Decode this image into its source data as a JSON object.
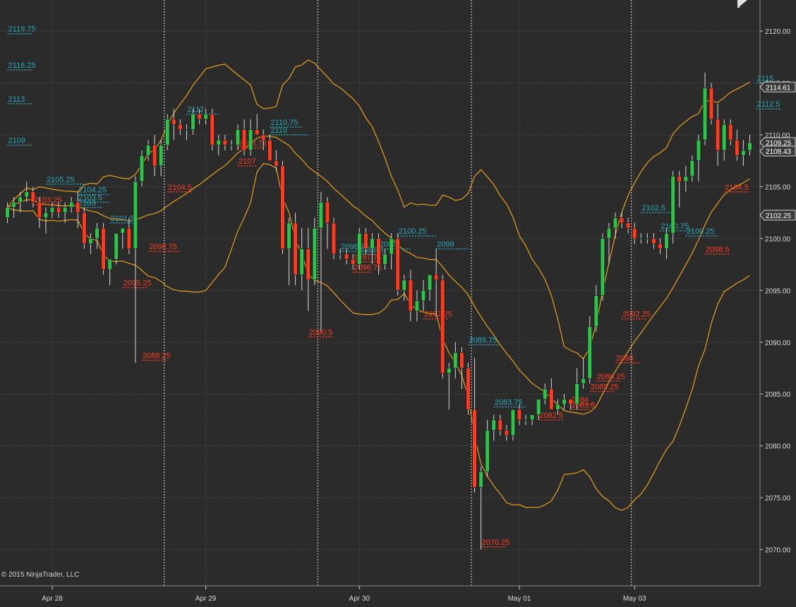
{
  "copyright": "© 2015 NinjaTrader, LLC",
  "colors": {
    "background": "#2b2b2b",
    "grid": "#555555",
    "separator": "#d8d8d8",
    "up_candle": "#2ec44a",
    "down_candle": "#ff3b1f",
    "wick": "#d8d8d8",
    "bollinger": "#e8a11a",
    "swing_high": "#2aa8b8",
    "swing_low": "#ff3b1f",
    "axis_text": "#d8d8d8"
  },
  "chart_data": {
    "type": "candlestick",
    "title": "",
    "xlabel": "",
    "ylabel": "",
    "ylim": [
      2066.5,
      2123.0
    ],
    "y_ticks": [
      2070.0,
      2075.0,
      2080.0,
      2085.0,
      2090.0,
      2095.0,
      2100.0,
      2105.0,
      2110.0,
      2115.0,
      2120.0
    ],
    "y_tick_labels": [
      "2070.00",
      "2075.00",
      "2080.00",
      "2085.00",
      "2090.00",
      "2095.00",
      "2100.00",
      "2105.00",
      "2110.00",
      "2115.00",
      "2120.00"
    ],
    "x_tick_labels": [
      "Apr 28",
      "Apr 29",
      "Apr 30",
      "May 01",
      "May 03"
    ],
    "x_tick_bars": [
      7,
      31,
      55,
      80,
      98
    ],
    "session_breaks": [
      25,
      49,
      73,
      98
    ],
    "grid": true,
    "price_markers": [
      {
        "label": "2114.61",
        "value": 2114.61
      },
      {
        "label": "2109.25",
        "value": 2109.25
      },
      {
        "label": "2108.43",
        "value": 2108.43
      },
      {
        "label": "2102.25",
        "value": 2102.25
      }
    ],
    "candles": [
      [
        2102.0,
        2103.5,
        2101.5,
        2103.0
      ],
      [
        2103.0,
        2104.0,
        2102.0,
        2103.5
      ],
      [
        2103.5,
        2104.5,
        2102.5,
        2104.0
      ],
      [
        2104.0,
        2105.5,
        2103.5,
        2104.5
      ],
      [
        2104.5,
        2105.0,
        2103.0,
        2103.5
      ],
      [
        2103.5,
        2104.0,
        2101.0,
        2102.0
      ],
      [
        2102.0,
        2103.0,
        2100.5,
        2102.5
      ],
      [
        2102.5,
        2103.5,
        2102.0,
        2103.0
      ],
      [
        2103.0,
        2103.5,
        2102.0,
        2102.5
      ],
      [
        2102.5,
        2103.5,
        2101.5,
        2103.0
      ],
      [
        2103.0,
        2104.0,
        2102.5,
        2103.5
      ],
      [
        2103.5,
        2104.5,
        2101.0,
        2102.5
      ],
      [
        2102.5,
        2103.0,
        2099.0,
        2099.5
      ],
      [
        2099.5,
        2100.5,
        2098.5,
        2100.0
      ],
      [
        2100.0,
        2101.5,
        2099.0,
        2101.0
      ],
      [
        2101.0,
        2101.5,
        2096.5,
        2097.0
      ],
      [
        2097.0,
        2098.0,
        2095.5,
        2098.0
      ],
      [
        2098.0,
        2100.5,
        2097.5,
        2100.5
      ],
      [
        2100.5,
        2101.0,
        2099.0,
        2101.0
      ],
      [
        2101.0,
        2102.0,
        2098.5,
        2099.0
      ],
      [
        2099.0,
        2106.0,
        2088.0,
        2105.5
      ],
      [
        2105.5,
        2108.5,
        2105.0,
        2108.0
      ],
      [
        2108.0,
        2109.5,
        2107.5,
        2109.0
      ],
      [
        2109.0,
        2110.0,
        2106.0,
        2107.0
      ],
      [
        2107.0,
        2109.5,
        2106.0,
        2109.0
      ],
      [
        2109.0,
        2112.0,
        2108.5,
        2111.5
      ],
      [
        2111.5,
        2112.5,
        2109.5,
        2111.0
      ],
      [
        2111.0,
        2111.5,
        2110.0,
        2110.5
      ],
      [
        2110.5,
        2111.0,
        2109.5,
        2110.5
      ],
      [
        2110.5,
        2112.5,
        2110.0,
        2112.0
      ],
      [
        2112.0,
        2112.5,
        2111.0,
        2111.5
      ],
      [
        2111.5,
        2112.5,
        2111.0,
        2112.0
      ],
      [
        2112.0,
        2112.5,
        2108.5,
        2109.0
      ],
      [
        2109.0,
        2110.0,
        2108.0,
        2109.5
      ],
      [
        2109.5,
        2110.0,
        2108.5,
        2109.0
      ],
      [
        2109.0,
        2109.5,
        2108.5,
        2109.0
      ],
      [
        2109.0,
        2111.0,
        2108.5,
        2110.5
      ],
      [
        2110.5,
        2111.5,
        2108.0,
        2108.5
      ],
      [
        2108.5,
        2111.5,
        2108.0,
        2110.5
      ],
      [
        2110.5,
        2112.0,
        2110.0,
        2110.0
      ],
      [
        2110.0,
        2110.5,
        2108.5,
        2109.5
      ],
      [
        2109.5,
        2110.0,
        2107.5,
        2107.5
      ],
      [
        2107.5,
        2108.5,
        2106.5,
        2107.0
      ],
      [
        2107.0,
        2107.5,
        2098.5,
        2099.0
      ],
      [
        2099.0,
        2102.0,
        2095.5,
        2101.5
      ],
      [
        2101.5,
        2102.5,
        2095.5,
        2096.5
      ],
      [
        2096.5,
        2101.0,
        2095.0,
        2099.0
      ],
      [
        2099.0,
        2101.0,
        2093.0,
        2096.0
      ],
      [
        2096.0,
        2102.0,
        2095.5,
        2101.0
      ],
      [
        2101.0,
        2104.5,
        2091.0,
        2103.5
      ],
      [
        2103.5,
        2104.0,
        2099.0,
        2101.5
      ],
      [
        2101.5,
        2102.0,
        2098.0,
        2098.5
      ],
      [
        2098.5,
        2099.0,
        2098.0,
        2098.5
      ],
      [
        2098.5,
        2099.0,
        2097.5,
        2098.0
      ],
      [
        2098.0,
        2098.5,
        2097.0,
        2097.5
      ],
      [
        2097.5,
        2101.0,
        2097.0,
        2100.5
      ],
      [
        2100.5,
        2101.0,
        2098.5,
        2099.0
      ],
      [
        2099.0,
        2100.5,
        2097.5,
        2100.0
      ],
      [
        2100.0,
        2100.5,
        2096.5,
        2097.5
      ],
      [
        2097.5,
        2099.0,
        2097.0,
        2098.5
      ],
      [
        2098.5,
        2100.5,
        2097.0,
        2100.0
      ],
      [
        2100.0,
        2100.5,
        2094.5,
        2095.0
      ],
      [
        2095.0,
        2096.5,
        2094.0,
        2096.0
      ],
      [
        2096.0,
        2097.0,
        2092.0,
        2093.0
      ],
      [
        2093.0,
        2095.0,
        2092.0,
        2094.0
      ],
      [
        2094.0,
        2096.0,
        2093.0,
        2095.0
      ],
      [
        2095.0,
        2096.5,
        2094.0,
        2096.5
      ],
      [
        2096.5,
        2099.0,
        2092.5,
        2096.0
      ],
      [
        2096.0,
        2096.5,
        2086.5,
        2087.0
      ],
      [
        2087.0,
        2088.0,
        2083.5,
        2087.5
      ],
      [
        2087.5,
        2090.0,
        2086.5,
        2089.0
      ],
      [
        2089.0,
        2089.5,
        2085.5,
        2087.5
      ],
      [
        2087.5,
        2088.0,
        2083.0,
        2083.5
      ],
      [
        2083.5,
        2088.5,
        2075.5,
        2076.0
      ],
      [
        2076.0,
        2078.0,
        2070.0,
        2077.5
      ],
      [
        2077.5,
        2082.5,
        2077.0,
        2081.5
      ],
      [
        2081.5,
        2083.0,
        2080.5,
        2082.5
      ],
      [
        2082.5,
        2083.0,
        2081.0,
        2081.5
      ],
      [
        2081.5,
        2082.0,
        2080.5,
        2081.0
      ],
      [
        2081.0,
        2083.5,
        2080.5,
        2083.5
      ],
      [
        2083.5,
        2084.0,
        2082.0,
        2082.5
      ],
      [
        2082.5,
        2083.0,
        2082.0,
        2082.5
      ],
      [
        2082.5,
        2083.0,
        2082.0,
        2083.0
      ],
      [
        2083.0,
        2084.5,
        2082.5,
        2084.5
      ],
      [
        2084.5,
        2086.0,
        2084.0,
        2085.5
      ],
      [
        2085.5,
        2086.5,
        2083.5,
        2083.5
      ],
      [
        2083.5,
        2084.5,
        2083.0,
        2084.0
      ],
      [
        2084.0,
        2085.0,
        2083.5,
        2084.5
      ],
      [
        2084.5,
        2084.5,
        2083.5,
        2084.0
      ],
      [
        2084.0,
        2087.5,
        2083.5,
        2086.0
      ],
      [
        2086.0,
        2088.5,
        2085.5,
        2086.5
      ],
      [
        2086.5,
        2092.5,
        2086.0,
        2091.5
      ],
      [
        2091.5,
        2095.5,
        2091.0,
        2094.5
      ],
      [
        2094.5,
        2100.5,
        2094.0,
        2100.0
      ],
      [
        2100.0,
        2101.5,
        2097.5,
        2101.0
      ],
      [
        2101.0,
        2102.5,
        2100.0,
        2102.0
      ],
      [
        2102.0,
        2102.5,
        2101.0,
        2101.5
      ],
      [
        2101.5,
        2102.0,
        2100.5,
        2101.0
      ],
      [
        2101.0,
        2101.5,
        2099.5,
        2100.0
      ],
      [
        2100.0,
        2100.5,
        2099.5,
        2100.0
      ],
      [
        2100.0,
        2100.5,
        2099.5,
        2100.0
      ],
      [
        2100.0,
        2100.5,
        2099.0,
        2099.5
      ],
      [
        2099.5,
        2100.0,
        2098.5,
        2099.0
      ],
      [
        2099.0,
        2101.0,
        2098.0,
        2100.5
      ],
      [
        2100.5,
        2106.5,
        2099.5,
        2106.0
      ],
      [
        2106.0,
        2106.5,
        2103.0,
        2105.5
      ],
      [
        2105.5,
        2107.0,
        2104.5,
        2106.0
      ],
      [
        2106.0,
        2108.0,
        2105.5,
        2107.5
      ],
      [
        2107.5,
        2110.0,
        2105.5,
        2109.5
      ],
      [
        2109.5,
        2116.0,
        2109.0,
        2114.5
      ],
      [
        2114.5,
        2115.0,
        2111.0,
        2111.5
      ],
      [
        2111.5,
        2113.0,
        2107.0,
        2108.5
      ],
      [
        2108.5,
        2111.5,
        2107.5,
        2111.0
      ],
      [
        2111.0,
        2111.5,
        2109.0,
        2109.5
      ],
      [
        2109.5,
        2110.5,
        2107.5,
        2108.0
      ],
      [
        2108.0,
        2109.5,
        2107.0,
        2108.5
      ],
      [
        2108.5,
        2110.0,
        2108.0,
        2109.25
      ]
    ],
    "swing_highs": [
      {
        "label": "2119.75",
        "value": 2119.75,
        "bar_from": 0,
        "bar_to": 4
      },
      {
        "label": "2116.25",
        "value": 2116.25,
        "bar_from": 0,
        "bar_to": 4
      },
      {
        "label": "2113",
        "value": 2113.0,
        "bar_from": 0,
        "bar_to": 4
      },
      {
        "label": "2109",
        "value": 2109.0,
        "bar_from": 0,
        "bar_to": 4
      },
      {
        "label": "2105.25",
        "value": 2105.25,
        "bar_from": 6,
        "bar_to": 12
      },
      {
        "label": "2104.25",
        "value": 2104.25,
        "bar_from": 11,
        "bar_to": 16
      },
      {
        "label": "2103.5",
        "value": 2103.5,
        "bar_from": 11,
        "bar_to": 16
      },
      {
        "label": "2103",
        "value": 2103.0,
        "bar_from": 11,
        "bar_to": 15
      },
      {
        "label": "2101.5",
        "value": 2101.5,
        "bar_from": 16,
        "bar_to": 20
      },
      {
        "label": "2112",
        "value": 2112.0,
        "bar_from": 28,
        "bar_to": 33
      },
      {
        "label": "2110.75",
        "value": 2110.75,
        "bar_from": 41,
        "bar_to": 46
      },
      {
        "label": "2110",
        "value": 2110.0,
        "bar_from": 41,
        "bar_to": 47
      },
      {
        "label": "2100.25",
        "value": 2100.25,
        "bar_from": 61,
        "bar_to": 67
      },
      {
        "label": "2099",
        "value": 2099.0,
        "bar_from": 58,
        "bar_to": 63
      },
      {
        "label": "2099",
        "value": 2099.0,
        "bar_from": 67,
        "bar_to": 72
      },
      {
        "label": "2098.75",
        "value": 2098.75,
        "bar_from": 52,
        "bar_to": 58
      },
      {
        "label": "2098.5",
        "value": 2098.5,
        "bar_from": 55,
        "bar_to": 59
      },
      {
        "label": "2089.75",
        "value": 2089.75,
        "bar_from": 72,
        "bar_to": 77
      },
      {
        "label": "2083.75",
        "value": 2083.75,
        "bar_from": 76,
        "bar_to": 81
      },
      {
        "label": "2102.5",
        "value": 2102.5,
        "bar_from": 99,
        "bar_to": 104
      },
      {
        "label": "2100.75",
        "value": 2100.75,
        "bar_from": 102,
        "bar_to": 107
      },
      {
        "label": "2100.25",
        "value": 2100.25,
        "bar_from": 106,
        "bar_to": 111
      },
      {
        "label": "2115",
        "value": 2115.0,
        "bar_from": 117,
        "bar_to": 121
      },
      {
        "label": "2112.5",
        "value": 2112.5,
        "bar_from": 117,
        "bar_to": 121
      }
    ],
    "swing_lows": [
      {
        "label": "2103.25",
        "value": 2103.25,
        "bar_from": 4,
        "bar_to": 8
      },
      {
        "label": "2098.75",
        "value": 2098.75,
        "bar_from": 22,
        "bar_to": 27
      },
      {
        "label": "2095.25",
        "value": 2095.25,
        "bar_from": 18,
        "bar_to": 22
      },
      {
        "label": "2088.25",
        "value": 2088.25,
        "bar_from": 21,
        "bar_to": 25
      },
      {
        "label": "2104.5",
        "value": 2104.5,
        "bar_from": 25,
        "bar_to": 29
      },
      {
        "label": "2108.75",
        "value": 2108.75,
        "bar_from": 36,
        "bar_to": 40
      },
      {
        "label": "2107",
        "value": 2107.0,
        "bar_from": 36,
        "bar_to": 39
      },
      {
        "label": "2097.75",
        "value": 2097.75,
        "bar_from": 54,
        "bar_to": 58
      },
      {
        "label": "2096.75",
        "value": 2096.75,
        "bar_from": 54,
        "bar_to": 57
      },
      {
        "label": "2092.25",
        "value": 2092.25,
        "bar_from": 65,
        "bar_to": 69
      },
      {
        "label": "2090.5",
        "value": 2090.5,
        "bar_from": 47,
        "bar_to": 51
      },
      {
        "label": "2070.25",
        "value": 2070.25,
        "bar_from": 74,
        "bar_to": 78
      },
      {
        "label": "2082.5",
        "value": 2082.5,
        "bar_from": 83,
        "bar_to": 87
      },
      {
        "label": "2084",
        "value": 2084.0,
        "bar_from": 88,
        "bar_to": 92
      },
      {
        "label": "2083.5",
        "value": 2083.5,
        "bar_from": 88,
        "bar_to": 91
      },
      {
        "label": "2085.25",
        "value": 2085.25,
        "bar_from": 91,
        "bar_to": 95
      },
      {
        "label": "2086.25",
        "value": 2086.25,
        "bar_from": 92,
        "bar_to": 96
      },
      {
        "label": "2088",
        "value": 2088.0,
        "bar_from": 95,
        "bar_to": 99
      },
      {
        "label": "2092.25",
        "value": 2092.25,
        "bar_from": 96,
        "bar_to": 100
      },
      {
        "label": "2098.5",
        "value": 2098.5,
        "bar_from": 109,
        "bar_to": 113
      },
      {
        "label": "2104.5",
        "value": 2104.5,
        "bar_from": 112,
        "bar_to": 116
      }
    ]
  }
}
